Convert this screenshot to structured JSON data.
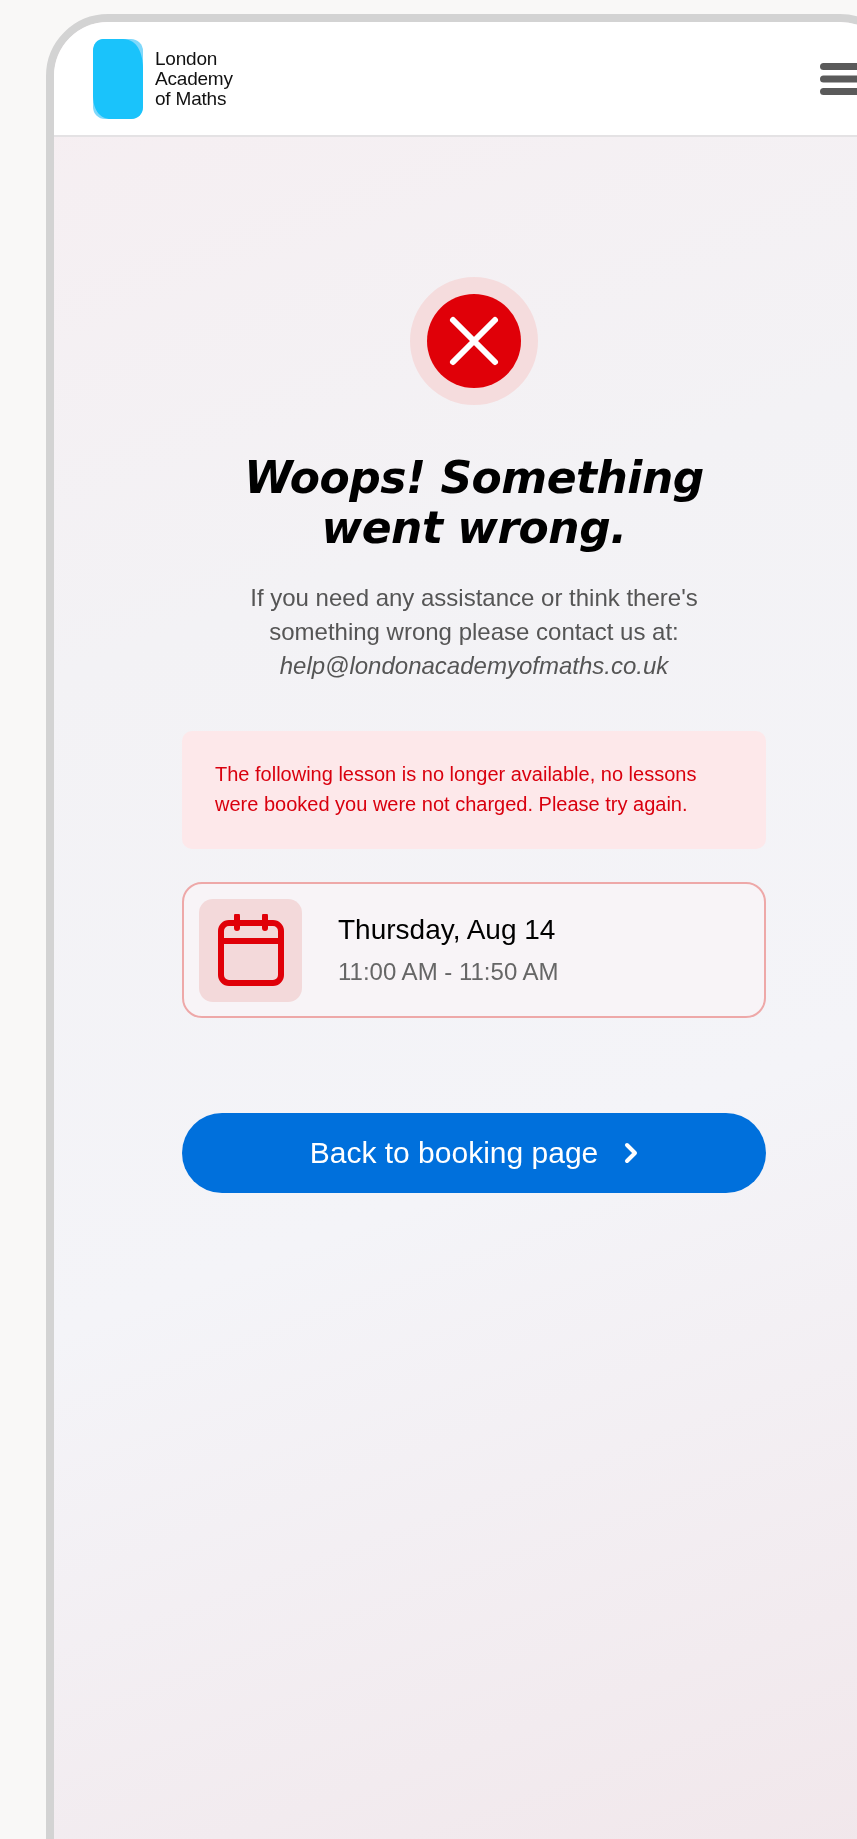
{
  "header": {
    "logo_lines": [
      "London",
      "Academy",
      "of Maths"
    ]
  },
  "error": {
    "title_lines": [
      "Woops! Something",
      "went wrong."
    ],
    "message": "If you need any assistance or think there's something wrong please contact us at:",
    "email": "help@londonacademyofmaths.co.uk"
  },
  "alert": {
    "text": "The following lesson is no longer available, no lessons were booked you were not charged. Please try again."
  },
  "lesson": {
    "date": "Thursday, Aug 14",
    "time": "11:00 AM - 11:50 AM"
  },
  "button": {
    "label": "Back to booking page"
  }
}
